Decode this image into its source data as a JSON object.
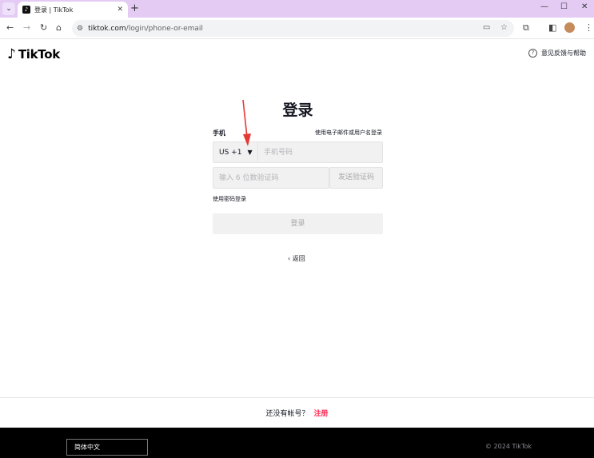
{
  "browser": {
    "tab_title": "登录 | TikTok",
    "tab_close": "✕",
    "new_tab": "+",
    "url_host": "tiktok.com",
    "url_path": "/login/phone-or-email",
    "window_controls": {
      "minimize": "—",
      "maximize": "☐",
      "close": "✕"
    }
  },
  "header": {
    "logo_text": "TikTok",
    "help_label": "意见反馈与帮助"
  },
  "login": {
    "title": "登录",
    "phone_label": "手机",
    "switch_to_email": "使用电子邮件或用户名登录",
    "country_code": "US +1",
    "phone_placeholder": "手机号码",
    "code_placeholder": "输入 6 位数验证码",
    "send_code": "发送验证码",
    "use_password": "使用密码登录",
    "submit": "登录",
    "back": "返回"
  },
  "signup": {
    "prompt": "还没有帐号？",
    "link": "注册"
  },
  "footer": {
    "language": "简体中文",
    "copyright": "© 2024 TikTok"
  },
  "colors": {
    "accent": "#fe2c55",
    "annotation_arrow": "#e53935"
  }
}
